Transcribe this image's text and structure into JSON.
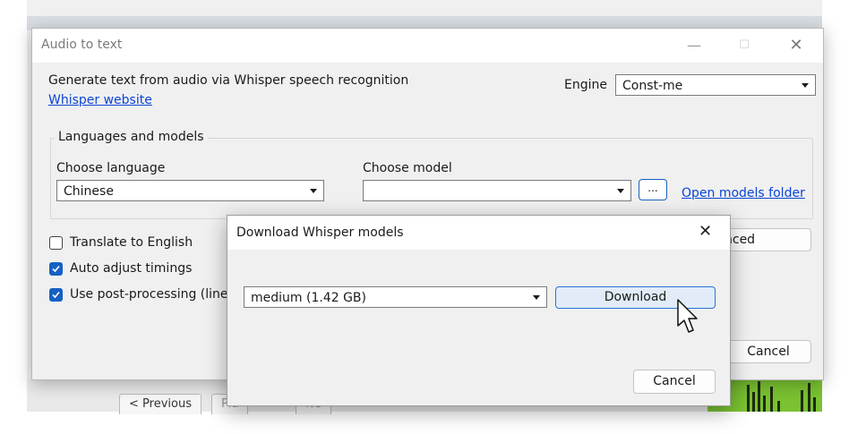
{
  "background_app": {
    "previous_label": "< Previous",
    "button2_label": "Pla",
    "button3_label": "Ne"
  },
  "main_dialog": {
    "title": "Audio to text",
    "description": "Generate text from audio via Whisper speech recognition",
    "whisper_link": "Whisper website",
    "engine_label": "Engine",
    "engine_value": "Const-me",
    "group_title": "Languages and models",
    "choose_language_label": "Choose language",
    "language_value": "Chinese",
    "choose_model_label": "Choose model",
    "model_value": "",
    "browse_label": "...",
    "open_models_link": "Open models folder",
    "translate_label": "Translate to English",
    "translate_checked": false,
    "auto_adjust_label": "Auto adjust timings",
    "auto_adjust_checked": true,
    "post_processing_label": "Use post-processing (line m",
    "post_processing_checked": true,
    "advanced_button_label": "nced",
    "cancel_label": "Cancel"
  },
  "download_dialog": {
    "title": "Download Whisper models",
    "model_value": "medium (1.42 GB)",
    "download_label": "Download",
    "cancel_label": "Cancel"
  },
  "colors": {
    "accent": "#1560c4",
    "link": "#0b45d6",
    "waveform": "#7ac231"
  },
  "icons": {
    "close": "close-icon",
    "minimize": "minimize-icon",
    "maximize": "maximize-icon",
    "dropdown": "chevron-down-icon",
    "checkmark": "checkmark-icon",
    "cursor": "hand-cursor-icon"
  }
}
